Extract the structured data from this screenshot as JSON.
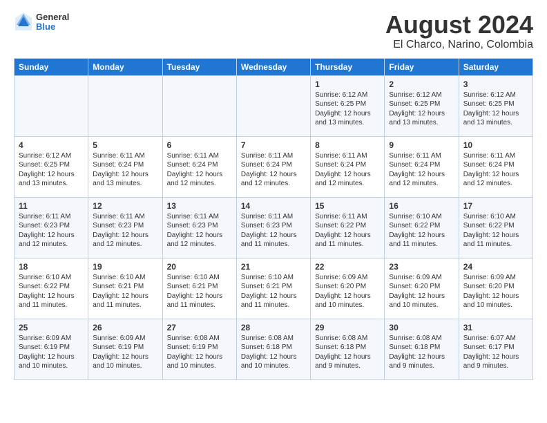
{
  "logo": {
    "general": "General",
    "blue": "Blue"
  },
  "title": "August 2024",
  "subtitle": "El Charco, Narino, Colombia",
  "days_of_week": [
    "Sunday",
    "Monday",
    "Tuesday",
    "Wednesday",
    "Thursday",
    "Friday",
    "Saturday"
  ],
  "weeks": [
    [
      {
        "day": "",
        "info": ""
      },
      {
        "day": "",
        "info": ""
      },
      {
        "day": "",
        "info": ""
      },
      {
        "day": "",
        "info": ""
      },
      {
        "day": "1",
        "info": "Sunrise: 6:12 AM\nSunset: 6:25 PM\nDaylight: 12 hours\nand 13 minutes."
      },
      {
        "day": "2",
        "info": "Sunrise: 6:12 AM\nSunset: 6:25 PM\nDaylight: 12 hours\nand 13 minutes."
      },
      {
        "day": "3",
        "info": "Sunrise: 6:12 AM\nSunset: 6:25 PM\nDaylight: 12 hours\nand 13 minutes."
      }
    ],
    [
      {
        "day": "4",
        "info": "Sunrise: 6:12 AM\nSunset: 6:25 PM\nDaylight: 12 hours\nand 13 minutes."
      },
      {
        "day": "5",
        "info": "Sunrise: 6:11 AM\nSunset: 6:24 PM\nDaylight: 12 hours\nand 13 minutes."
      },
      {
        "day": "6",
        "info": "Sunrise: 6:11 AM\nSunset: 6:24 PM\nDaylight: 12 hours\nand 12 minutes."
      },
      {
        "day": "7",
        "info": "Sunrise: 6:11 AM\nSunset: 6:24 PM\nDaylight: 12 hours\nand 12 minutes."
      },
      {
        "day": "8",
        "info": "Sunrise: 6:11 AM\nSunset: 6:24 PM\nDaylight: 12 hours\nand 12 minutes."
      },
      {
        "day": "9",
        "info": "Sunrise: 6:11 AM\nSunset: 6:24 PM\nDaylight: 12 hours\nand 12 minutes."
      },
      {
        "day": "10",
        "info": "Sunrise: 6:11 AM\nSunset: 6:24 PM\nDaylight: 12 hours\nand 12 minutes."
      }
    ],
    [
      {
        "day": "11",
        "info": "Sunrise: 6:11 AM\nSunset: 6:23 PM\nDaylight: 12 hours\nand 12 minutes."
      },
      {
        "day": "12",
        "info": "Sunrise: 6:11 AM\nSunset: 6:23 PM\nDaylight: 12 hours\nand 12 minutes."
      },
      {
        "day": "13",
        "info": "Sunrise: 6:11 AM\nSunset: 6:23 PM\nDaylight: 12 hours\nand 12 minutes."
      },
      {
        "day": "14",
        "info": "Sunrise: 6:11 AM\nSunset: 6:23 PM\nDaylight: 12 hours\nand 11 minutes."
      },
      {
        "day": "15",
        "info": "Sunrise: 6:11 AM\nSunset: 6:22 PM\nDaylight: 12 hours\nand 11 minutes."
      },
      {
        "day": "16",
        "info": "Sunrise: 6:10 AM\nSunset: 6:22 PM\nDaylight: 12 hours\nand 11 minutes."
      },
      {
        "day": "17",
        "info": "Sunrise: 6:10 AM\nSunset: 6:22 PM\nDaylight: 12 hours\nand 11 minutes."
      }
    ],
    [
      {
        "day": "18",
        "info": "Sunrise: 6:10 AM\nSunset: 6:22 PM\nDaylight: 12 hours\nand 11 minutes."
      },
      {
        "day": "19",
        "info": "Sunrise: 6:10 AM\nSunset: 6:21 PM\nDaylight: 12 hours\nand 11 minutes."
      },
      {
        "day": "20",
        "info": "Sunrise: 6:10 AM\nSunset: 6:21 PM\nDaylight: 12 hours\nand 11 minutes."
      },
      {
        "day": "21",
        "info": "Sunrise: 6:10 AM\nSunset: 6:21 PM\nDaylight: 12 hours\nand 11 minutes."
      },
      {
        "day": "22",
        "info": "Sunrise: 6:09 AM\nSunset: 6:20 PM\nDaylight: 12 hours\nand 10 minutes."
      },
      {
        "day": "23",
        "info": "Sunrise: 6:09 AM\nSunset: 6:20 PM\nDaylight: 12 hours\nand 10 minutes."
      },
      {
        "day": "24",
        "info": "Sunrise: 6:09 AM\nSunset: 6:20 PM\nDaylight: 12 hours\nand 10 minutes."
      }
    ],
    [
      {
        "day": "25",
        "info": "Sunrise: 6:09 AM\nSunset: 6:19 PM\nDaylight: 12 hours\nand 10 minutes."
      },
      {
        "day": "26",
        "info": "Sunrise: 6:09 AM\nSunset: 6:19 PM\nDaylight: 12 hours\nand 10 minutes."
      },
      {
        "day": "27",
        "info": "Sunrise: 6:08 AM\nSunset: 6:19 PM\nDaylight: 12 hours\nand 10 minutes."
      },
      {
        "day": "28",
        "info": "Sunrise: 6:08 AM\nSunset: 6:18 PM\nDaylight: 12 hours\nand 10 minutes."
      },
      {
        "day": "29",
        "info": "Sunrise: 6:08 AM\nSunset: 6:18 PM\nDaylight: 12 hours\nand 9 minutes."
      },
      {
        "day": "30",
        "info": "Sunrise: 6:08 AM\nSunset: 6:18 PM\nDaylight: 12 hours\nand 9 minutes."
      },
      {
        "day": "31",
        "info": "Sunrise: 6:07 AM\nSunset: 6:17 PM\nDaylight: 12 hours\nand 9 minutes."
      }
    ]
  ]
}
